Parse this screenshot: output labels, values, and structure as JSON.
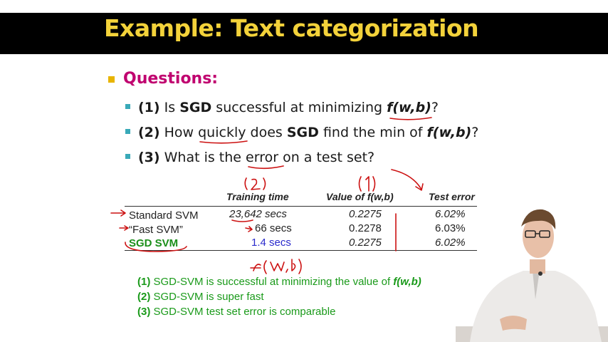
{
  "slide": {
    "title": "Example: Text categorization",
    "questions_heading": "Questions:",
    "questions": [
      {
        "num": "(1)",
        "pre": " Is ",
        "bold": "SGD",
        "mid": " successful at minimizing ",
        "formula": "f(w,b)",
        "post": "?"
      },
      {
        "num": "(2)",
        "pre": " How quickly does ",
        "bold": "SGD",
        "mid": " find the min of ",
        "formula": "f(w,b)",
        "post": "?"
      },
      {
        "num": "(3)",
        "pre": " What is the error on a test set?",
        "bold": "",
        "mid": "",
        "formula": "",
        "post": ""
      }
    ]
  },
  "table": {
    "headers": [
      "Training time",
      "Value of f(w,b)",
      "Test error"
    ],
    "rows": [
      {
        "name": "Standard SVM",
        "time": "23,642 secs",
        "value": "0.2275",
        "error": "6.02%"
      },
      {
        "name": "“Fast SVM”",
        "time": "66 secs",
        "value": "0.2278",
        "error": "6.03%"
      },
      {
        "name": "SGD SVM",
        "time": "1.4 secs",
        "value": "0.2275",
        "error": "6.02%"
      }
    ]
  },
  "conclusions": [
    {
      "num": "(1)",
      "text": " SGD-SVM is successful at minimizing the value of ",
      "formula": "f(w,b)"
    },
    {
      "num": "(2)",
      "text": " SGD-SVM is super fast",
      "formula": ""
    },
    {
      "num": "(3)",
      "text": " SGD-SVM test set error is comparable",
      "formula": ""
    }
  ],
  "colors": {
    "title": "#f3d23a",
    "heading": "#c0006f",
    "sub_bullet": "#39a9b8",
    "conclusion": "#1a9a1a",
    "ink": "#cc1111"
  }
}
